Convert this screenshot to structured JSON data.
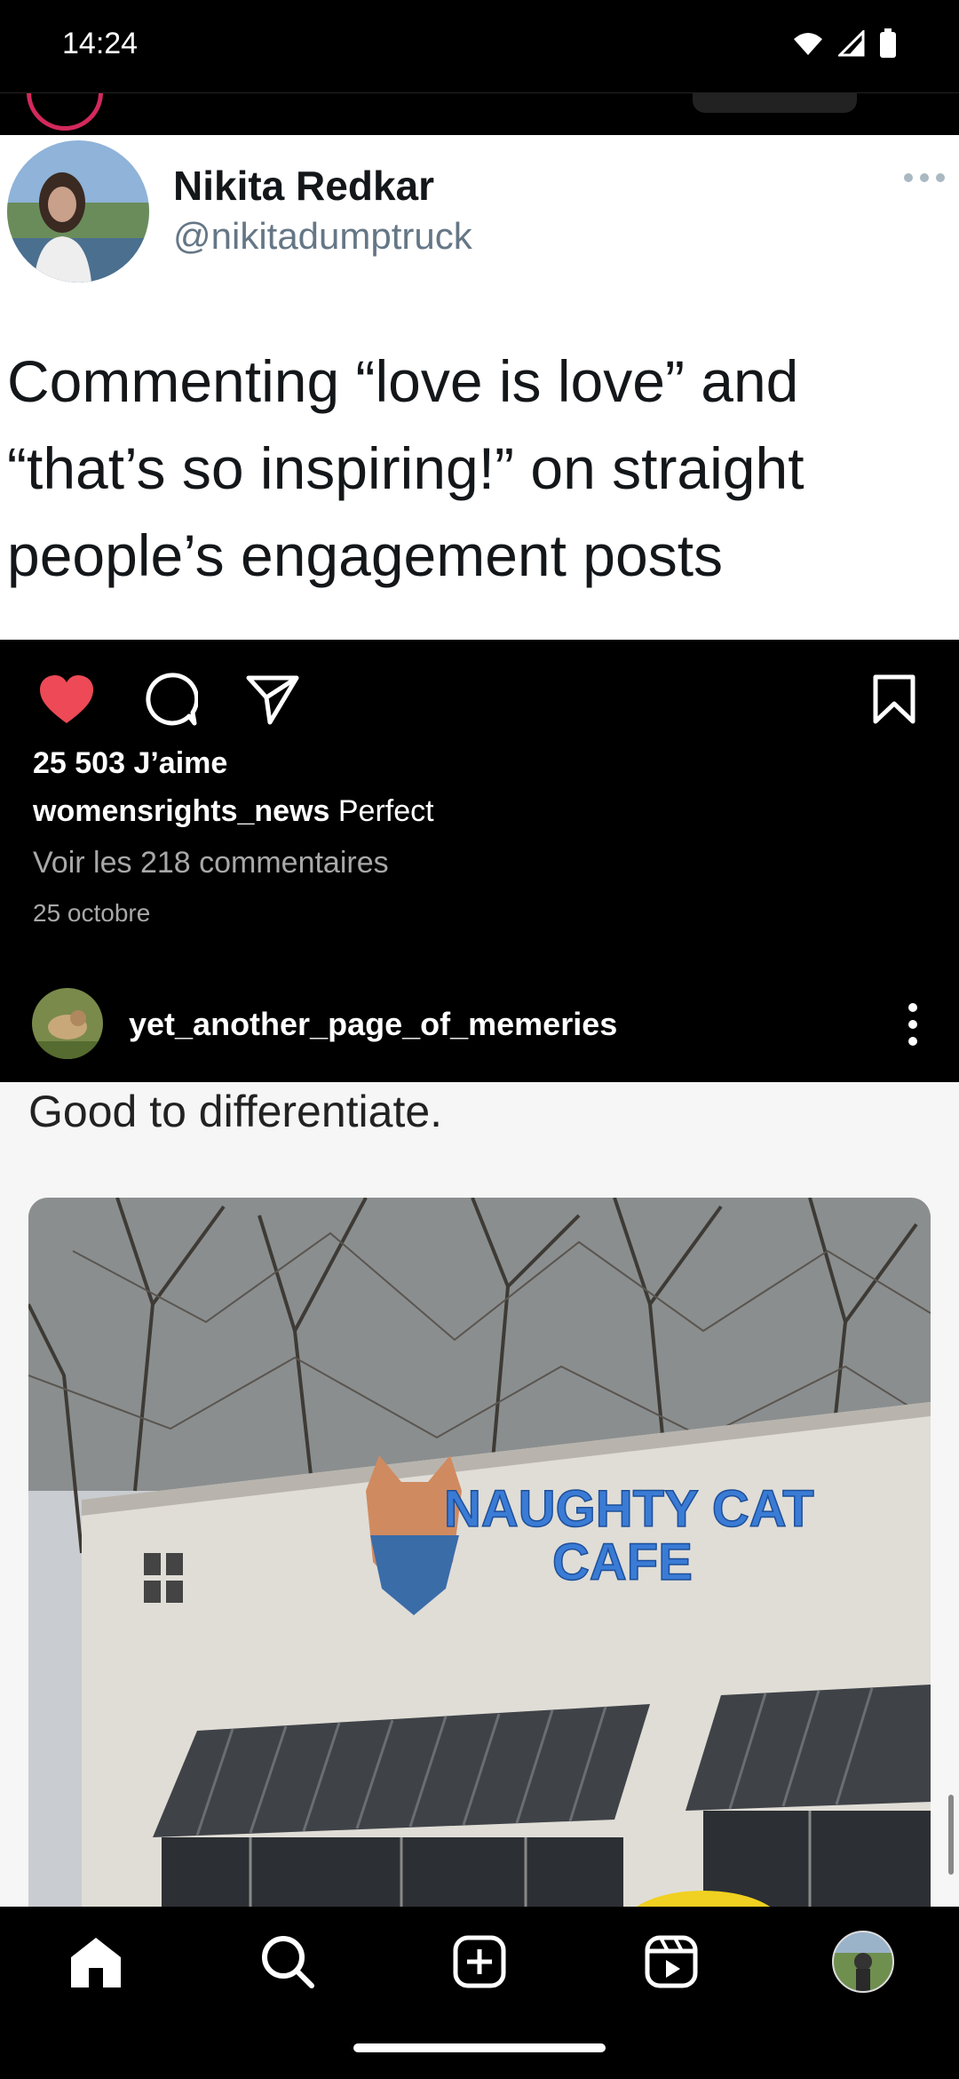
{
  "status_bar": {
    "time": "14:24"
  },
  "tweet": {
    "name": "Nikita Redkar",
    "handle": "@nikitadumptruck",
    "lines": [
      "Commenting “love is love” and",
      "“that’s so inspiring!” on straight",
      "people’s engagement posts"
    ]
  },
  "post1": {
    "likes_text": "25 503 J’aime",
    "caption_user": "womensrights_news",
    "caption_text": "Perfect",
    "view_comments": "Voir les 218 commentaires",
    "date": "25 octobre",
    "liked": true
  },
  "post2": {
    "username": "yet_another_page_of_memeries",
    "caption": "Good to differentiate.",
    "sign_line1": "NAUGHTY CAT",
    "sign_line2": "CAFE"
  },
  "icons": {
    "like": "heart-icon",
    "comment": "comment-bubble-icon",
    "share": "paper-plane-icon",
    "save": "bookmark-icon",
    "nav": [
      "home-icon",
      "search-icon",
      "add-post-icon",
      "reels-icon",
      "profile-avatar"
    ]
  },
  "colors": {
    "like_red": "#ed4956",
    "sign_blue": "#3a7bd5"
  }
}
